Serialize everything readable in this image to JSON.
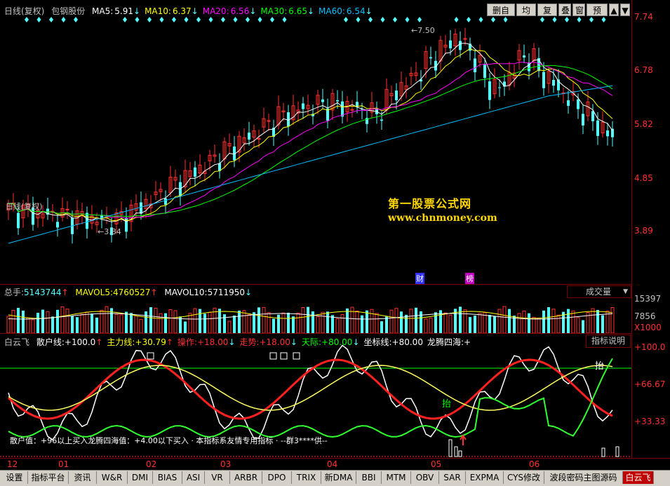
{
  "main_chart": {
    "title": "日线(复权)",
    "stock_name": "包钢股份",
    "ma": [
      {
        "label": "MA5:",
        "value": "5.91",
        "arrow": "↓",
        "color": "#ffffff"
      },
      {
        "label": "MA10:",
        "value": "6.37",
        "arrow": "↓",
        "color": "#ffff00"
      },
      {
        "label": "MA20:",
        "value": "6.56",
        "arrow": "↓",
        "color": "#ff00ff"
      },
      {
        "label": "MA30:",
        "value": "6.65",
        "arrow": "↓",
        "color": "#00ff00"
      },
      {
        "label": "MA60:",
        "value": "6.54",
        "arrow": "↓",
        "color": "#00c0ff"
      }
    ],
    "price_axis": [
      "7.74",
      "6.78",
      "5.82",
      "4.85",
      "3.89"
    ],
    "high_mark": "7.50",
    "low_mark": "3.84",
    "legend": "日线(复权)",
    "watermark_title": "第一股票公式网",
    "watermark_url": "www.chnmoney.com",
    "badge_fin": "财",
    "badge_rank": "榜"
  },
  "toolbar": {
    "del_watch": "删自选",
    "ma_line": "均线",
    "restore": "复权",
    "overlay": "叠",
    "window": "窗",
    "forecast": "预测"
  },
  "volume_chart": {
    "total_label": "总手:",
    "total_value": "5143744",
    "total_arrow": "↑",
    "mavol5_label": "MAVOL5:",
    "mavol5_value": "4760527",
    "mavol5_arrow": "↑",
    "mavol10_label": "MAVOL10:",
    "mavol10_value": "5711950",
    "mavol10_arrow": "↓",
    "selector": "成交量",
    "axis": [
      "15397",
      "7856",
      "X1000"
    ]
  },
  "indicator": {
    "name": "白云飞",
    "items": [
      {
        "label": "散户线:",
        "value": "+100.0",
        "arrow": "↑",
        "color": "#ffffff"
      },
      {
        "label": "主力线:",
        "value": "+30.79",
        "arrow": "↑",
        "color": "#ffff00"
      },
      {
        "label": "操作:",
        "value": "+18.00",
        "arrow": "↓",
        "color": "#ff3030"
      },
      {
        "label": "走势:",
        "value": "+18.00",
        "arrow": "↓",
        "color": "#ff3030"
      },
      {
        "label": "天际:",
        "value": "+80.00",
        "arrow": "↓",
        "color": "#00ff00"
      },
      {
        "label": "坐标线:",
        "value": "+80.00",
        "arrow": "",
        "color": "#ffffff"
      },
      {
        "label": "龙腾四海:",
        "value": "+",
        "arrow": "",
        "color": "#ffffff"
      }
    ],
    "help_button": "指标说明",
    "axis": [
      "+100.0",
      "+66.67",
      "+33.33"
    ],
    "annotation_1": "抬",
    "annotation_2": "抬",
    "description": "散户值：+96以上买入龙腾四海值：+4.00以下买入 · 本指标系友情专用指标 · --群3****供--"
  },
  "time_axis": [
    "12",
    "01",
    "02",
    "03",
    "04",
    "05",
    "06"
  ],
  "tabs": [
    "设置",
    "指标平台",
    "资讯",
    "W&R",
    "DMI",
    "BIAS",
    "ASI",
    "VR",
    "ARBR",
    "DPO",
    "TRIX",
    "新DMA",
    "BBI",
    "MTM",
    "OBV",
    "SAR",
    "EXPMA",
    "CYS修改",
    "波段密码主图源码",
    "白云飞"
  ],
  "active_tab": "白云飞",
  "colors": {
    "up_candle": "#ff3030",
    "down_candle": "#54ffff",
    "grid_border": "#7a0000",
    "ma5": "#ffffff",
    "ma10": "#ffff00",
    "ma20": "#ff00ff",
    "ma30": "#00ff00",
    "ma60": "#00c0ff"
  }
}
